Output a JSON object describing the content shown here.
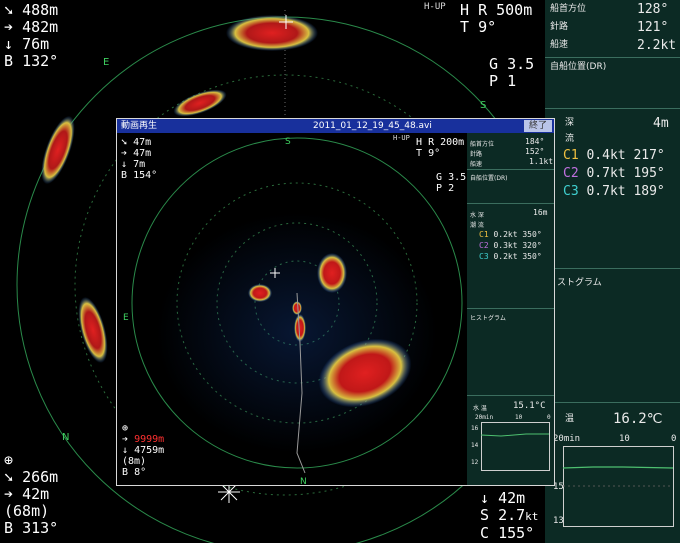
{
  "main": {
    "top_left": [
      {
        "icon": "diag-arrow-icon",
        "value": "488m"
      },
      {
        "icon": "right-arrow-icon",
        "value": "482m"
      },
      {
        "icon": "down-arrow-icon",
        "value": "76m"
      },
      {
        "label": "B",
        "value": "132°"
      }
    ],
    "top_right": {
      "mode": "H-UP",
      "h": "H",
      "r_label": "R",
      "range": "500m",
      "t_label": "T",
      "t_value": "9°",
      "g_label": "G",
      "gain": "3.5",
      "p_label": "P",
      "p_value": "1"
    },
    "bottom_left": {
      "cross": "⊕",
      "rows": [
        {
          "icon": "diag-arrow-icon",
          "value": "266m"
        },
        {
          "icon": "right-arrow-icon",
          "value": "42m"
        },
        {
          "value": "(68m)"
        },
        {
          "label": "B",
          "value": "313°"
        }
      ]
    },
    "bottom_right": {
      "rows": [
        {
          "icon": "down-arrow-icon",
          "value": "42m"
        },
        {
          "label": "S",
          "value": "2.7",
          "unit": "kt"
        },
        {
          "label": "C",
          "value": "155°"
        }
      ]
    },
    "ring_letters": [
      "E",
      "S",
      "E",
      "N"
    ]
  },
  "side": {
    "heading_label": "船首方位",
    "heading": "128°",
    "course_label": "針路",
    "course": "121°",
    "speed_label": "船速",
    "speed": "2.2kt",
    "position_label": "自船位置(DR)",
    "depth_label": "深",
    "depth": "4m",
    "current_label": "流",
    "currents": [
      {
        "name": "C1",
        "speed": "0.4kt",
        "dir": "217°",
        "color": "#f0c040"
      },
      {
        "name": "C2",
        "speed": "0.7kt",
        "dir": "195°",
        "color": "#c070e0"
      },
      {
        "name": "C3",
        "speed": "0.7kt",
        "dir": "189°",
        "color": "#40d0d0"
      }
    ],
    "histogram_label": "ストグラム",
    "temp_label": "温",
    "temp": "16.2℃",
    "graph_top": [
      "20min",
      "10",
      "0"
    ],
    "graph_left": [
      "15",
      "13"
    ]
  },
  "player": {
    "title_left": "動画再生",
    "filename": "2011_01_12_19_45_48.avi",
    "close": "終了",
    "left": [
      {
        "icon": "diag-arrow-icon",
        "value": "47m"
      },
      {
        "icon": "right-arrow-icon",
        "value": "47m"
      },
      {
        "icon": "down-arrow-icon",
        "value": "7m"
      },
      {
        "label": "B",
        "value": "154°"
      }
    ],
    "right": {
      "mode": "H-UP",
      "h": "H",
      "r": "R",
      "range": "200m",
      "t": "T",
      "tv": "9°",
      "g": "G",
      "gain": "3.5",
      "p": "P",
      "pv": "2"
    },
    "side": {
      "heading_label": "船首方位",
      "heading": "184°",
      "course_label": "針路",
      "course": "152°",
      "speed_label": "船速",
      "speed": "1.1kt",
      "position_label": "自船位置(DR)",
      "depth_label": "水 深",
      "depth": "16m",
      "current_label": "潮 流",
      "currents": [
        {
          "name": "C1",
          "val": "0.2kt 350°",
          "color": "#f0c040"
        },
        {
          "name": "C2",
          "val": "0.3kt 320°",
          "color": "#c070e0"
        },
        {
          "name": "C3",
          "val": "0.2kt 350°",
          "color": "#40d0d0"
        }
      ],
      "histogram_label": "ヒストグラム",
      "temp_label": "水 温",
      "temp": "15.1°C",
      "graph_top": [
        "20min",
        "10",
        "0"
      ],
      "graph_left": [
        "16",
        "14",
        "12"
      ]
    },
    "bottom": {
      "cross": "⊕",
      "r1": "9999m",
      "r2": "4759m",
      "r3": "(8m)",
      "b": "B",
      "bv": "8°"
    }
  }
}
